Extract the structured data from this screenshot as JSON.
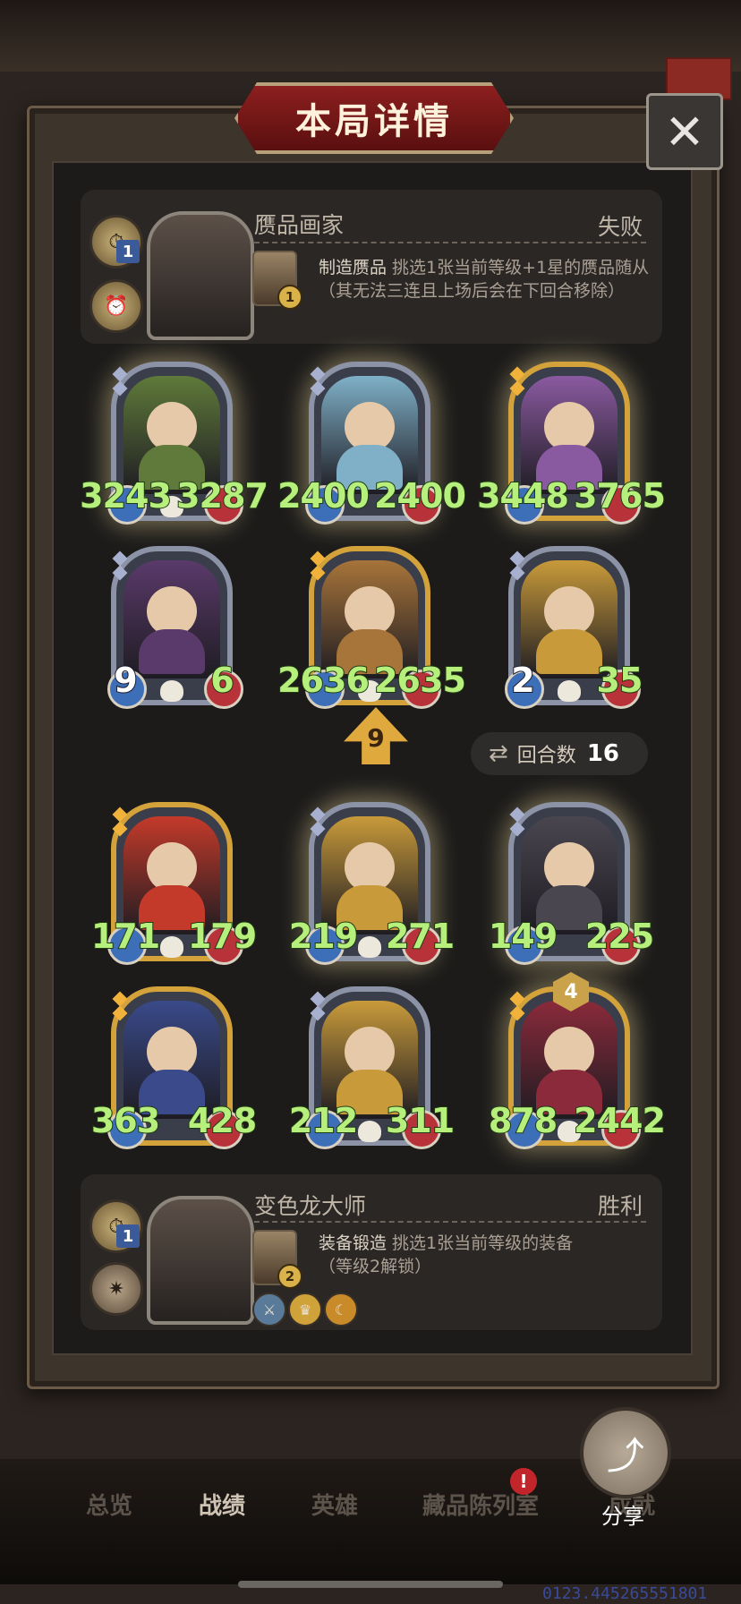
{
  "header": {
    "title": "本局详情",
    "close_glyph": "✕"
  },
  "opponent": {
    "name": "赝品画家",
    "result": "失败",
    "level_tag": "1",
    "skill": {
      "badge": "1",
      "name": "制造赝品",
      "desc_line1": " 挑选1张当前等级+1星的赝品随从",
      "desc_line2": "（其无法三连且上场后会在下回合移除）"
    }
  },
  "enemy_board": [
    {
      "atk": "3243",
      "hp": "3287",
      "style": "silver",
      "color": "#5f7a3a",
      "skull": true
    },
    {
      "atk": "2400",
      "hp": "2400",
      "style": "silver",
      "color": "#7fb0c8",
      "skull": false
    },
    {
      "atk": "3448",
      "hp": "3765",
      "style": "gold",
      "color": "#8a5aa0",
      "skull": false
    },
    {
      "atk": "9",
      "hp": "6",
      "style": "silver",
      "color": "#5a3a6a",
      "skull": true
    },
    {
      "atk": "2636",
      "hp": "2635",
      "style": "gold",
      "color": "#a7743a",
      "skull": true
    },
    {
      "atk": "2",
      "hp": "35",
      "style": "silver",
      "color": "#c89a3a",
      "skull": true
    }
  ],
  "tavern_level": "9",
  "round": {
    "label": "回合数",
    "value": "16"
  },
  "my_board": [
    {
      "atk": "171",
      "hp": "179",
      "style": "gold",
      "color": "#c43a2a",
      "skull": true
    },
    {
      "atk": "219",
      "hp": "271",
      "style": "silver",
      "color": "#c89a3a",
      "skull": true
    },
    {
      "atk": "149",
      "hp": "225",
      "style": "silver",
      "color": "#4a4650",
      "skull": false
    },
    {
      "atk": "363",
      "hp": "428",
      "style": "gold",
      "color": "#3a4a8a",
      "skull": false
    },
    {
      "atk": "212",
      "hp": "311",
      "style": "silver",
      "color": "#c89a3a",
      "skull": true
    },
    {
      "atk": "878",
      "hp": "2442",
      "style": "gold",
      "color": "#8a2a3a",
      "skull": true,
      "tier": "4"
    }
  ],
  "player": {
    "name": "变色龙大师",
    "result": "胜利",
    "level_tag": "1",
    "skill": {
      "badge": "2",
      "name": "装备锻造",
      "desc_line1": " 挑选1张当前等级的装备",
      "desc_line2": "（等级2解锁）"
    },
    "equipment_icons": [
      "sword-icon",
      "crown-icon",
      "claw-icon"
    ]
  },
  "nav": {
    "items": [
      "总览",
      "战绩",
      "英雄",
      "藏品陈列室",
      "成就"
    ],
    "active": 1,
    "badge": "!"
  },
  "share": {
    "label": "分享"
  },
  "footer_number": "0123.445265551801"
}
